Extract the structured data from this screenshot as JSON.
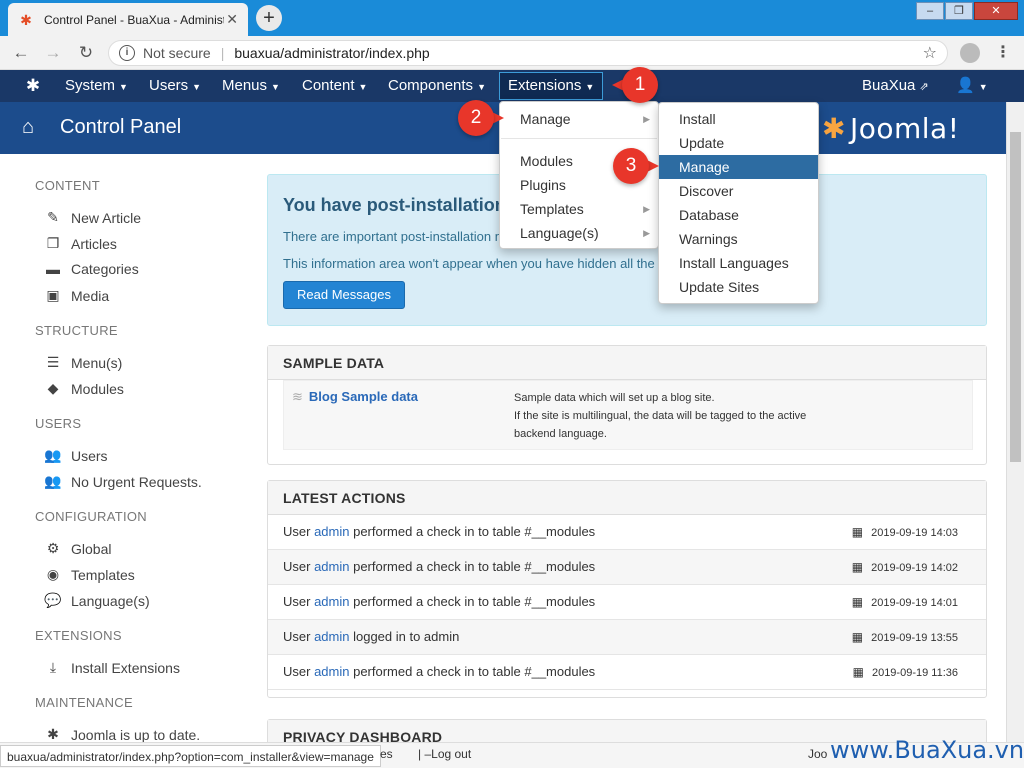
{
  "browser": {
    "tab_title": "Control Panel - BuaXua - Administrat",
    "not_secure": "Not secure",
    "url": "buaxua/administrator/index.php"
  },
  "topnav": {
    "items": [
      {
        "label": "System"
      },
      {
        "label": "Users"
      },
      {
        "label": "Menus"
      },
      {
        "label": "Content"
      },
      {
        "label": "Components"
      },
      {
        "label": "Extensions"
      }
    ],
    "site_link": "BuaXua"
  },
  "header": {
    "title": "Control Panel",
    "brand": "Joomla!"
  },
  "sidebar": {
    "sections": [
      {
        "heading": "CONTENT",
        "items": [
          {
            "label": "New Article",
            "icon": "pencil-icon"
          },
          {
            "label": "Articles",
            "icon": "copy-icon"
          },
          {
            "label": "Categories",
            "icon": "folder-icon"
          },
          {
            "label": "Media",
            "icon": "image-icon"
          }
        ]
      },
      {
        "heading": "STRUCTURE",
        "items": [
          {
            "label": "Menu(s)",
            "icon": "list-icon"
          },
          {
            "label": "Modules",
            "icon": "cube-icon"
          }
        ]
      },
      {
        "heading": "USERS",
        "items": [
          {
            "label": "Users",
            "icon": "users-icon"
          },
          {
            "label": "No Urgent Requests.",
            "icon": "users-icon"
          }
        ]
      },
      {
        "heading": "CONFIGURATION",
        "items": [
          {
            "label": "Global",
            "icon": "cog-icon"
          },
          {
            "label": "Templates",
            "icon": "eye-icon"
          },
          {
            "label": "Language(s)",
            "icon": "comments-icon"
          }
        ]
      },
      {
        "heading": "EXTENSIONS",
        "items": [
          {
            "label": "Install Extensions",
            "icon": "download-icon"
          }
        ]
      },
      {
        "heading": "MAINTENANCE",
        "items": [
          {
            "label": "Joomla is up to date.",
            "icon": "joomla-icon"
          }
        ]
      }
    ]
  },
  "postinstall": {
    "title": "You have post-installation",
    "line1": "There are important post-installation m",
    "line2": "This information area won't appear when you have hidden all the m",
    "button": "Read Messages"
  },
  "sample_data": {
    "heading": "SAMPLE DATA",
    "link": "Blog Sample data",
    "desc1": "Sample data which will set up a blog site.",
    "desc2": "If the site is multilingual, the data will be tagged to the active",
    "desc3": "backend language."
  },
  "latest_actions": {
    "heading": "LATEST ACTIONS",
    "rows": [
      {
        "pre": "User ",
        "user": "admin",
        "post": " performed a check in to table #__modules",
        "date": "2019-09-19 14:03"
      },
      {
        "pre": "User ",
        "user": "admin",
        "post": " performed a check in to table #__modules",
        "date": "2019-09-19 14:02"
      },
      {
        "pre": "User ",
        "user": "admin",
        "post": " performed a check in to table #__modules",
        "date": "2019-09-19 14:01"
      },
      {
        "pre": "User ",
        "user": "admin",
        "post": " logged in to admin",
        "date": "2019-09-19 13:55"
      },
      {
        "pre": "User ",
        "user": "admin",
        "post": " performed a check in to table #__modules",
        "date": "2019-09-19 11:36"
      }
    ]
  },
  "privacy": {
    "heading": "PRIVACY DASHBOARD"
  },
  "extensions_menu": {
    "items": [
      "Manage",
      "Modules",
      "Plugins",
      "Templates",
      "Language(s)"
    ]
  },
  "manage_submenu": {
    "items": [
      "Install",
      "Update",
      "Manage",
      "Discover",
      "Database",
      "Warnings",
      "Install Languages",
      "Update Sites"
    ]
  },
  "statusbar": {
    "url_tip": "buaxua/administrator/index.php?option=com_installer&view=manage",
    "partial": "es",
    "logout": "Log out",
    "partial2": "Joo"
  },
  "watermark": "www.BuaXua.vn",
  "callouts": [
    "1",
    "2",
    "3"
  ]
}
